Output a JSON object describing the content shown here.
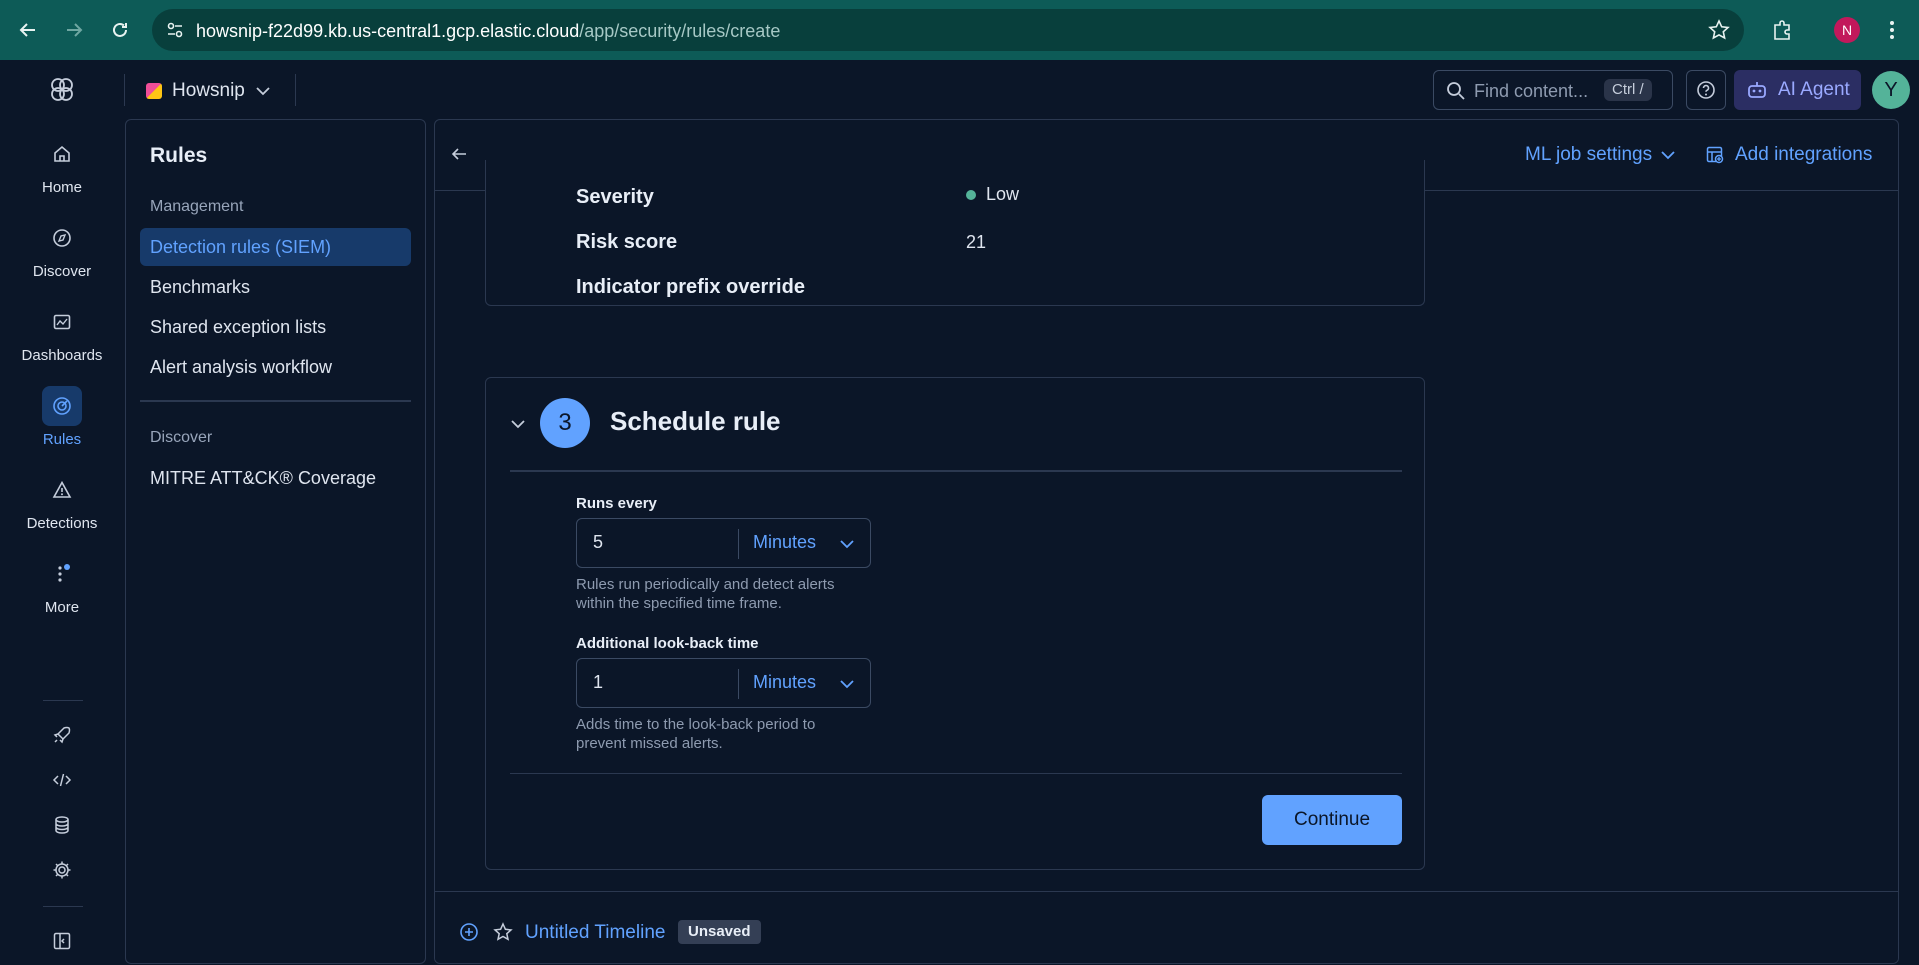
{
  "browser": {
    "url_host": "howsnip-f22d99.kb.us-central1.gcp.elastic.cloud",
    "url_path": "/app/security/rules/create",
    "profile_initial": "N"
  },
  "header": {
    "space_name": "Howsnip",
    "search_placeholder": "Find content...",
    "search_shortcut": "Ctrl /",
    "ai_agent_label": "AI Agent",
    "user_initial": "Y"
  },
  "leftnav": {
    "items": [
      {
        "label": "Home",
        "icon": "home-icon"
      },
      {
        "label": "Discover",
        "icon": "compass-icon"
      },
      {
        "label": "Dashboards",
        "icon": "dashboard-icon"
      },
      {
        "label": "Rules",
        "icon": "radar-icon",
        "active": true
      },
      {
        "label": "Detections",
        "icon": "warning-icon"
      },
      {
        "label": "More",
        "icon": "more-icon"
      }
    ],
    "tools": [
      "rocket-icon",
      "code-icon",
      "database-icon",
      "gear-icon",
      "panel-icon"
    ]
  },
  "sidenav": {
    "title": "Rules",
    "section_management": "Management",
    "items_management": [
      "Detection rules (SIEM)",
      "Benchmarks",
      "Shared exception lists",
      "Alert analysis workflow"
    ],
    "section_discover": "Discover",
    "items_discover": [
      "MITRE ATT&CK® Coverage"
    ]
  },
  "toolbar": {
    "ml_job_settings": "ML job settings",
    "add_integrations": "Add integrations"
  },
  "about": {
    "severity_label": "Severity",
    "severity_value": "Low",
    "risk_label": "Risk score",
    "risk_value": "21",
    "indicator_label": "Indicator prefix override"
  },
  "schedule": {
    "step": "3",
    "title": "Schedule rule",
    "runs_every_label": "Runs every",
    "runs_every_value": "5",
    "runs_every_unit": "Minutes",
    "runs_every_help": "Rules run periodically and detect alerts within the specified time frame.",
    "lookback_label": "Additional look-back time",
    "lookback_value": "1",
    "lookback_unit": "Minutes",
    "lookback_help": "Adds time to the look-back period to prevent missed alerts.",
    "continue_label": "Continue"
  },
  "timeline": {
    "title": "Untitled Timeline",
    "status": "Unsaved"
  },
  "colors": {
    "accent": "#61a2ff",
    "background": "#0b1628",
    "browser_chrome": "#0d5b57",
    "severity_low": "#54b399"
  }
}
